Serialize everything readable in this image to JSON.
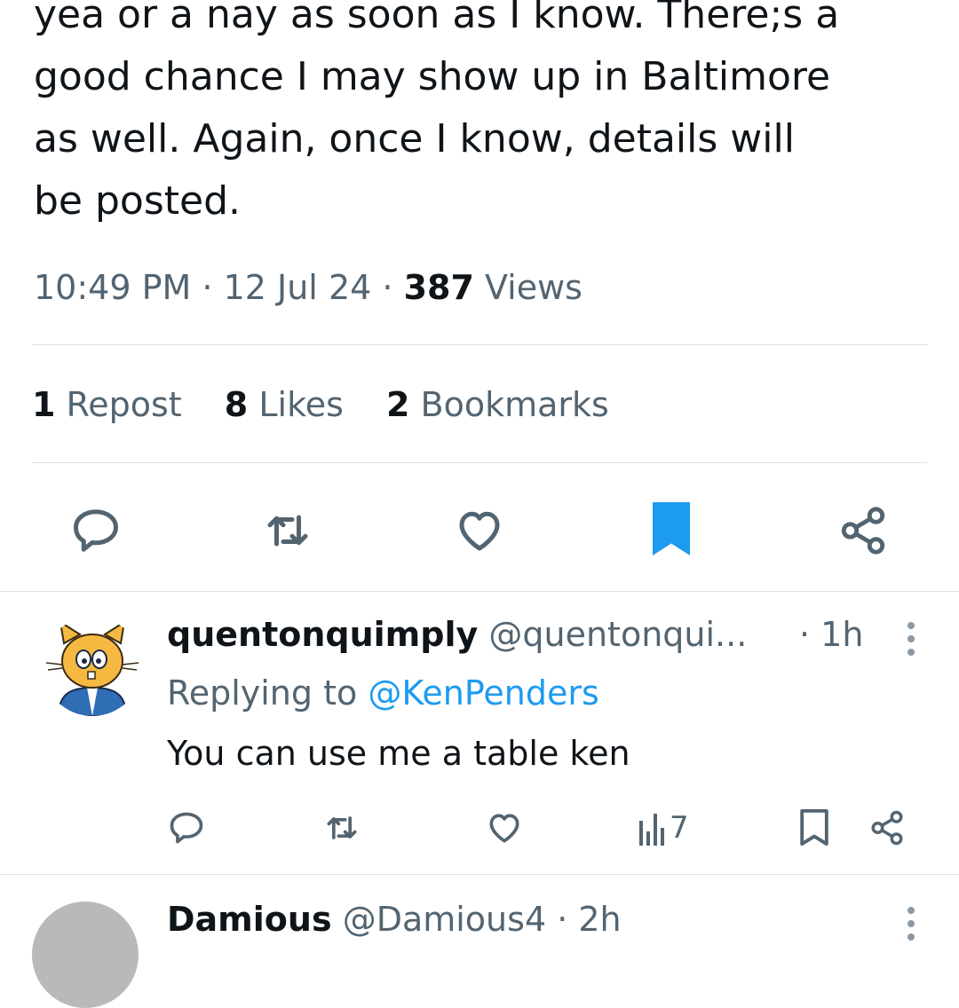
{
  "tweet": {
    "text_lines": [
      "yea or a nay as soon as I know. There;s a",
      "good chance I may show up in Baltimore",
      "as well. Again, once I know, details will",
      "be posted."
    ],
    "time": "10:49 PM",
    "date": "12 Jul 24",
    "separator": "·",
    "views_count": "387",
    "views_label": "Views"
  },
  "stats": {
    "reposts_count": "1",
    "reposts_label": "Repost",
    "likes_count": "8",
    "likes_label": "Likes",
    "bookmarks_count": "2",
    "bookmarks_label": "Bookmarks"
  },
  "actions": [
    "reply-icon",
    "repost-icon",
    "like-icon",
    "bookmark-filled-icon",
    "share-icon"
  ],
  "colors": {
    "accent": "#1d9bf0",
    "secondary_text": "#536471",
    "divider": "#dde1e4",
    "text": "#0f1419"
  },
  "replies": [
    {
      "name": "quentonquimply",
      "handle": "@quentonqui...",
      "time": "· 1h",
      "replying_prefix": "Replying to",
      "replying_to": "@KenPenders",
      "body": "You can use me a table ken",
      "views": "7"
    },
    {
      "name": "Damious",
      "handle": "@Damious4",
      "time": "· 2h"
    }
  ]
}
